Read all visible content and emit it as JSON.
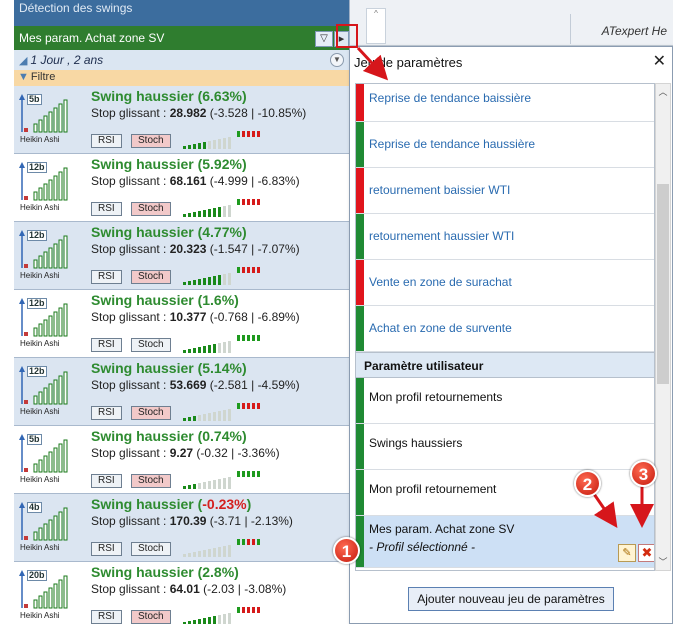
{
  "left_panel": {
    "title": "Détection des swings",
    "profile": "Mes param. Achat zone SV",
    "period": "1 Jour , 2 ans",
    "filter": "Filtre",
    "swings": [
      {
        "timeframe": "5b",
        "thumb_label": "Heikin Ashi",
        "title": "Swing haussier (6.63%)",
        "title_neg": "",
        "stop_label": "Stop glissant : ",
        "stop_value": "28.982",
        "stop_detail": " (-3.528 | -10.85%)",
        "rsi": "RSI",
        "stoch": "Stoch",
        "stoch_alert": true,
        "bar_level": 5,
        "bar_colors": [
          "#1a8a1a",
          "#1a8a1a",
          "#1a8a1a",
          "#1a8a1a",
          "#1a8a1a",
          "#cfd6cf",
          "#cfd6cf",
          "#cfd6cf",
          "#cfd6cf",
          "#cfd6cf"
        ],
        "dots": [
          "#1e9a1e",
          "#d61a1a",
          "#d61a1a",
          "#d61a1a",
          "#d61a1a"
        ]
      },
      {
        "timeframe": "12b",
        "thumb_label": "Heikin Ashi",
        "title": "Swing haussier (5.92%)",
        "title_neg": "",
        "stop_label": "Stop glissant : ",
        "stop_value": "68.161",
        "stop_detail": " (-4.999 | -6.83%)",
        "rsi": "RSI",
        "stoch": "Stoch",
        "stoch_alert": true,
        "bar_level": 8,
        "bar_colors": [
          "#1a8a1a",
          "#1a8a1a",
          "#1a8a1a",
          "#1a8a1a",
          "#1a8a1a",
          "#1a8a1a",
          "#1a8a1a",
          "#1a8a1a",
          "#cfd6cf",
          "#cfd6cf"
        ],
        "dots": [
          "#1e9a1e",
          "#d61a1a",
          "#d61a1a",
          "#d61a1a",
          "#d61a1a"
        ]
      },
      {
        "timeframe": "12b",
        "thumb_label": "Heikin Ashi",
        "title": "Swing haussier (4.77%)",
        "title_neg": "",
        "stop_label": "Stop glissant : ",
        "stop_value": "20.323",
        "stop_detail": " (-1.547 | -7.07%)",
        "rsi": "RSI",
        "stoch": "Stoch",
        "stoch_alert": true,
        "bar_level": 8,
        "bar_colors": [
          "#1a8a1a",
          "#1a8a1a",
          "#1a8a1a",
          "#1a8a1a",
          "#1a8a1a",
          "#1a8a1a",
          "#1a8a1a",
          "#1a8a1a",
          "#cfd6cf",
          "#cfd6cf"
        ],
        "dots": [
          "#1e9a1e",
          "#d61a1a",
          "#d61a1a",
          "#d61a1a",
          "#d61a1a"
        ]
      },
      {
        "timeframe": "12b",
        "thumb_label": "Heikin Ashi",
        "title": "Swing haussier (1.6%)",
        "title_neg": "",
        "stop_label": "Stop glissant : ",
        "stop_value": "10.377",
        "stop_detail": " (-0.768 | -6.89%)",
        "rsi": "RSI",
        "stoch": "Stoch",
        "stoch_alert": false,
        "bar_level": 7,
        "bar_colors": [
          "#1a8a1a",
          "#1a8a1a",
          "#1a8a1a",
          "#1a8a1a",
          "#1a8a1a",
          "#1a8a1a",
          "#1a8a1a",
          "#cfd6cf",
          "#cfd6cf",
          "#cfd6cf"
        ],
        "dots": [
          "#1e9a1e",
          "#1e9a1e",
          "#1e9a1e",
          "#1e9a1e",
          "#1e9a1e"
        ]
      },
      {
        "timeframe": "12b",
        "thumb_label": "Heikin Ashi",
        "title": "Swing haussier (5.14%)",
        "title_neg": "",
        "stop_label": "Stop glissant : ",
        "stop_value": "53.669",
        "stop_detail": " (-2.581 | -4.59%)",
        "rsi": "RSI",
        "stoch": "Stoch",
        "stoch_alert": true,
        "bar_level": 3,
        "bar_colors": [
          "#1a8a1a",
          "#1a8a1a",
          "#1a8a1a",
          "#cfd6cf",
          "#cfd6cf",
          "#cfd6cf",
          "#cfd6cf",
          "#cfd6cf",
          "#cfd6cf",
          "#cfd6cf"
        ],
        "dots": [
          "#1e9a1e",
          "#d61a1a",
          "#d61a1a",
          "#d61a1a",
          "#d61a1a"
        ]
      },
      {
        "timeframe": "5b",
        "thumb_label": "Heikin Ashi",
        "title": "Swing haussier (0.74%)",
        "title_neg": "",
        "stop_label": "Stop glissant : ",
        "stop_value": "9.27",
        "stop_detail": " (-0.32 | -3.36%)",
        "rsi": "RSI",
        "stoch": "Stoch",
        "stoch_alert": true,
        "bar_level": 3,
        "bar_colors": [
          "#1a8a1a",
          "#1a8a1a",
          "#1a8a1a",
          "#cfd6cf",
          "#cfd6cf",
          "#cfd6cf",
          "#cfd6cf",
          "#cfd6cf",
          "#cfd6cf",
          "#cfd6cf"
        ],
        "dots": [
          "#1e9a1e",
          "#1e9a1e",
          "#1e9a1e",
          "#1e9a1e",
          "#1e9a1e"
        ]
      },
      {
        "timeframe": "4b",
        "thumb_label": "Heikin Ashi",
        "title": "Swing haussier (",
        "title_neg": "-0.23%",
        "title_end": ")",
        "stop_label": "Stop glissant : ",
        "stop_value": "170.39",
        "stop_detail": " (-3.71 | -2.13%)",
        "rsi": "RSI",
        "stoch": "Stoch",
        "stoch_alert": false,
        "bar_level": 0,
        "bar_colors": [
          "#cfd6cf",
          "#cfd6cf",
          "#cfd6cf",
          "#cfd6cf",
          "#cfd6cf",
          "#cfd6cf",
          "#cfd6cf",
          "#cfd6cf",
          "#cfd6cf",
          "#cfd6cf"
        ],
        "dots": [
          "#1e9a1e",
          "#1e9a1e",
          "#d61a1a",
          "#d61a1a",
          "#1e9a1e"
        ]
      },
      {
        "timeframe": "20b",
        "thumb_label": "Heikin Ashi",
        "title": "Swing haussier (2.8%)",
        "title_neg": "",
        "stop_label": "Stop glissant : ",
        "stop_value": "64.01",
        "stop_detail": " (-2.03 | -3.08%)",
        "rsi": "RSI",
        "stoch": "Stoch",
        "stoch_alert": true,
        "bar_level": 7,
        "bar_colors": [
          "#1a8a1a",
          "#1a8a1a",
          "#1a8a1a",
          "#1a8a1a",
          "#1a8a1a",
          "#1a8a1a",
          "#1a8a1a",
          "#cfd6cf",
          "#cfd6cf",
          "#cfd6cf"
        ],
        "dots": [
          "#1e9a1e",
          "#d61a1a",
          "#d61a1a",
          "#d61a1a",
          "#d61a1a"
        ]
      }
    ]
  },
  "top_strip": {
    "text": "ATexpert He"
  },
  "dialog": {
    "title": "Jeu de paramètres",
    "close": "✕",
    "items": [
      {
        "label": "Reprise de tendance baissière",
        "mark": "red"
      },
      {
        "label": "Reprise de tendance haussière",
        "mark": "green"
      },
      {
        "label": "retournement baissier WTI",
        "mark": "red"
      },
      {
        "label": "retournement haussier WTI",
        "mark": "green"
      },
      {
        "label": "Vente en zone de surachat",
        "mark": "red"
      },
      {
        "label": "Achat en zone de survente",
        "mark": "green"
      }
    ],
    "section": "Paramètre utilisateur",
    "user_items": [
      {
        "label": "Mon profil retournements",
        "mark": "green"
      },
      {
        "label": "Swings haussiers",
        "mark": "green"
      },
      {
        "label": "Mon profil retournement",
        "mark": "green"
      }
    ],
    "selected": {
      "label": "Mes param. Achat zone SV",
      "sub": "- Profil sélectionné -",
      "mark": "green"
    },
    "add_button": "Ajouter nouveau jeu de paramètres"
  },
  "annotations": {
    "n1": "1",
    "n2": "2",
    "n3": "3"
  },
  "colors": {
    "green": "#208a34",
    "red": "#e0151c",
    "accent": "#3c6d9e"
  }
}
